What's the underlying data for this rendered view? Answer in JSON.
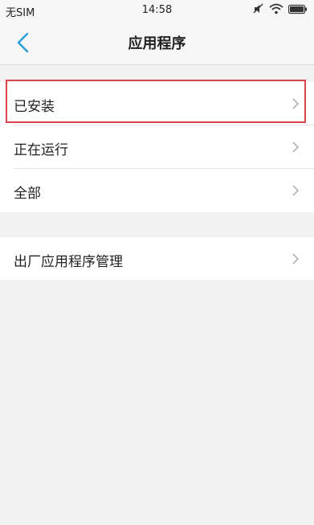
{
  "status_bar": {
    "carrier": "无SIM",
    "time": "14:58",
    "icons": [
      "mute-icon",
      "wifi-icon",
      "battery-icon"
    ]
  },
  "header": {
    "title": "应用程序",
    "back_icon": "chevron-left-icon"
  },
  "groups": [
    {
      "items": [
        {
          "label": "已安装",
          "highlighted": true
        },
        {
          "label": "正在运行"
        },
        {
          "label": "全部"
        }
      ]
    },
    {
      "items": [
        {
          "label": "出厂应用程序管理"
        }
      ]
    }
  ],
  "colors": {
    "accent": "#2a9fd6",
    "highlight": "#d9454f",
    "background": "#f2f2f2"
  }
}
